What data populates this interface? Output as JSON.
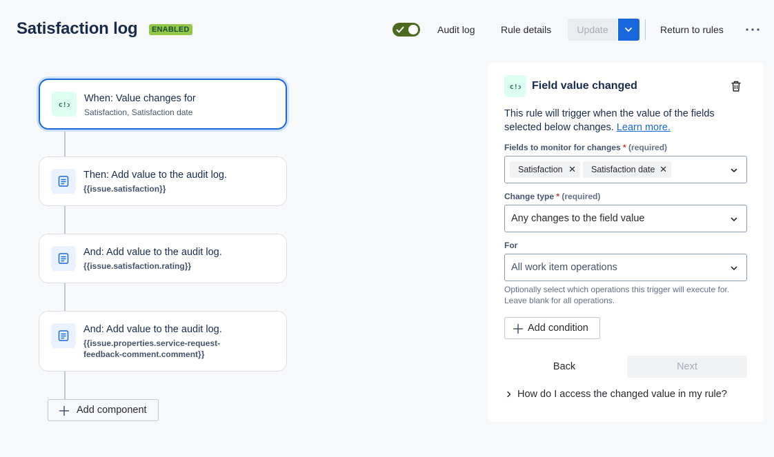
{
  "header": {
    "title": "Satisfaction log",
    "status_badge": "ENABLED",
    "toggle_enabled": true,
    "audit_log": "Audit log",
    "rule_details": "Rule details",
    "update": "Update",
    "return_to_rules": "Return to rules"
  },
  "flow": {
    "steps": [
      {
        "title": "When: Value changes for",
        "subtitle": "Satisfaction, Satisfaction date",
        "icon": "field-change-icon",
        "selected": true
      },
      {
        "title": "Then: Add value to the audit log.",
        "subtitle": "{{issue.satisfaction}}",
        "icon": "audit-log-icon"
      },
      {
        "title": "And: Add value to the audit log.",
        "subtitle": "{{issue.satisfaction.rating}}",
        "icon": "audit-log-icon"
      },
      {
        "title": "And: Add value to the audit log.",
        "subtitle": "{{issue.properties.service-request-feedback-comment.comment}}",
        "subtitle_line1": "{{issue.properties.service-request-",
        "subtitle_line2": "feedback-comment.comment}}",
        "icon": "audit-log-icon"
      }
    ],
    "add_component": "Add component"
  },
  "panel": {
    "title": "Field value changed",
    "description": "This rule will trigger when the value of the fields selected below changes.",
    "learn_more": "Learn more.",
    "fields_label": "Fields to monitor for changes",
    "required_mark": "*",
    "required_text": "(required)",
    "fields_tags": [
      "Satisfaction",
      "Satisfaction date"
    ],
    "change_type_label": "Change type",
    "change_type_value": "Any changes to the field value",
    "for_label": "For",
    "for_value": "All work item operations",
    "helper": "Optionally select which operations this trigger will execute for. Leave blank for all operations.",
    "add_condition": "Add condition",
    "back": "Back",
    "next": "Next",
    "faq": "How do I access the changed value in my rule?"
  },
  "colors": {
    "accent": "#1868db",
    "badge_bg": "#94c748",
    "toggle_on": "#4c6b1f"
  }
}
